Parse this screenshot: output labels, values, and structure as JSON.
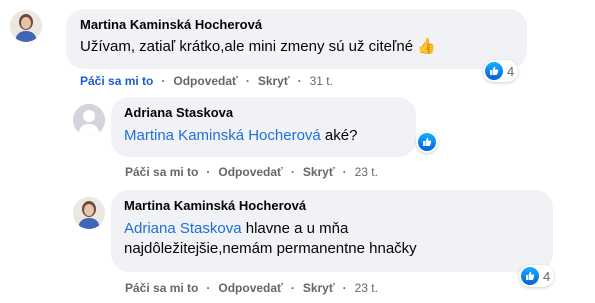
{
  "comments": [
    {
      "author": "Martina Kaminská Hocherová",
      "text": "Užívam, zatiaľ krátko,ale mini zmeny sú už citeľné",
      "emoji": "👍",
      "reaction_count": "4",
      "actions": {
        "like": "Páči sa mi to",
        "reply": "Odpovedať",
        "hide": "Skryť",
        "time": "31 t."
      }
    },
    {
      "author": "Adriana Staskova",
      "mention": "Martina Kaminská Hocherová",
      "text": " aké?",
      "actions": {
        "like": "Páči sa mi to",
        "reply": "Odpovedať",
        "hide": "Skryť",
        "time": "23 t."
      }
    },
    {
      "author": "Martina Kaminská Hocherová",
      "mention": "Adriana Staskova",
      "text_line1": " hlavne a u mňa",
      "text_line2": "najdôležitejšie,nemám permanentne hnačky",
      "reaction_count": "4",
      "actions": {
        "like": "Páči sa mi to",
        "reply": "Odpovedať",
        "hide": "Skryť",
        "time": "23 t."
      }
    }
  ],
  "colors": {
    "bubble": "#f0f2f5",
    "link": "#216fdb",
    "like_active": "#1b5cd6",
    "meta": "#65676b"
  }
}
